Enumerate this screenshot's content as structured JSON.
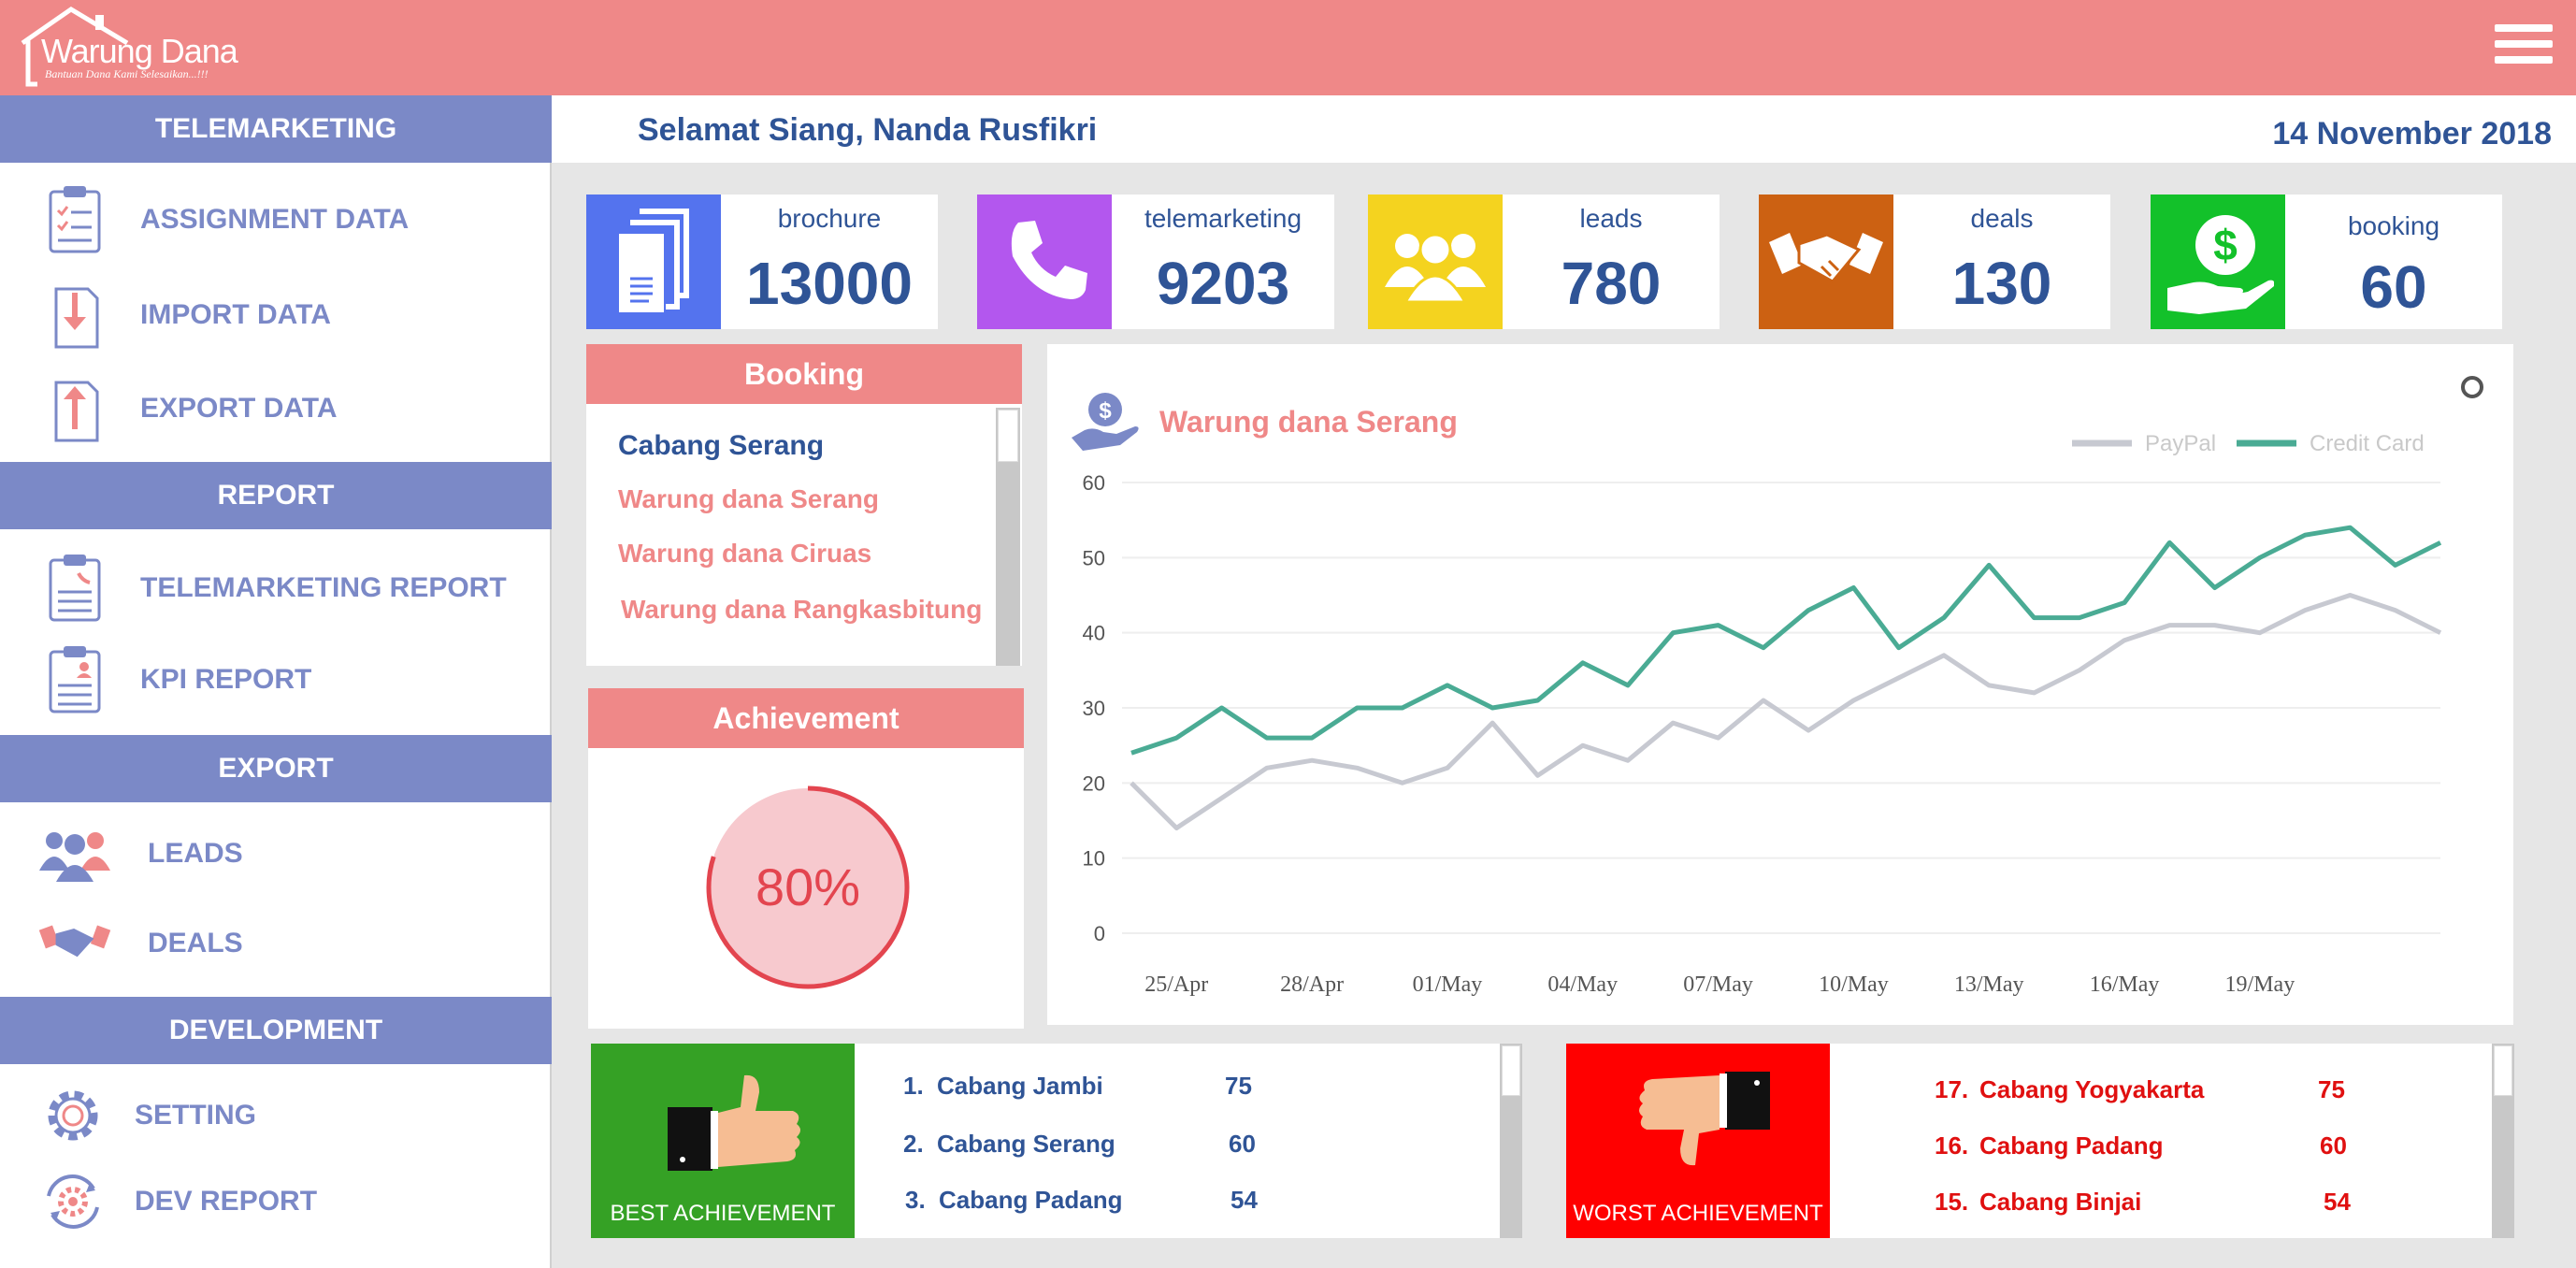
{
  "app": {
    "brand": "Warung Dana",
    "tagline": "Bantuan Dana Kami Selesaikan...!!!"
  },
  "sidebar": {
    "sections": [
      {
        "title": "TELEMARKETING",
        "items": [
          {
            "label": "ASSIGNMENT DATA",
            "icon": "clipboard-checklist-icon"
          },
          {
            "label": "IMPORT DATA",
            "icon": "import-document-icon"
          },
          {
            "label": "EXPORT DATA",
            "icon": "export-document-icon"
          }
        ]
      },
      {
        "title": "REPORT",
        "items": [
          {
            "label": "TELEMARKETING REPORT",
            "icon": "phone-report-icon"
          },
          {
            "label": "KPI REPORT",
            "icon": "person-report-icon"
          }
        ]
      },
      {
        "title": "EXPORT",
        "items": [
          {
            "label": "LEADS",
            "icon": "group-people-icon"
          },
          {
            "label": "DEALS",
            "icon": "handshake-icon"
          }
        ]
      },
      {
        "title": "DEVELOPMENT",
        "items": [
          {
            "label": "SETTING",
            "icon": "gear-icon"
          },
          {
            "label": "DEV REPORT",
            "icon": "gear-cycle-icon"
          }
        ]
      }
    ]
  },
  "header": {
    "greeting": "Selamat Siang, Nanda Rusfikri",
    "date": "14 November 2018"
  },
  "stats": [
    {
      "label": "brochure",
      "value": "13000",
      "color": "#5473ee",
      "icon": "brochure-icon"
    },
    {
      "label": "telemarketing",
      "value": "9203",
      "color": "#b357ee",
      "icon": "phone-icon"
    },
    {
      "label": "leads",
      "value": "780",
      "color": "#f4d31f",
      "icon": "group-people-icon"
    },
    {
      "label": "deals",
      "value": "130",
      "color": "#cc6112",
      "icon": "handshake-icon"
    },
    {
      "label": "booking",
      "value": "60",
      "color": "#13c12a",
      "icon": "money-hand-icon"
    }
  ],
  "booking": {
    "title": "Booking",
    "branch": "Cabang Serang",
    "items": [
      "Warung dana Serang",
      "Warung dana Ciruas",
      "Warung dana Rangkasbitung"
    ]
  },
  "achievement": {
    "title": "Achievement",
    "percent_label": "80%",
    "percent": 80
  },
  "chart_data": {
    "type": "line",
    "title": "Warung dana Serang",
    "legend_position": "top-right",
    "x_tick_labels": [
      "25/Apr",
      "28/Apr",
      "01/May",
      "04/May",
      "07/May",
      "10/May",
      "13/May",
      "16/May",
      "19/May"
    ],
    "y_ticks": [
      0,
      10,
      20,
      30,
      40,
      50,
      60
    ],
    "ylim": [
      0,
      60
    ],
    "grid": true,
    "series": [
      {
        "name": "PayPal",
        "color": "#c7c9d1",
        "values": [
          20,
          14,
          18,
          22,
          23,
          22,
          20,
          22,
          28,
          21,
          25,
          23,
          28,
          26,
          31,
          27,
          31,
          34,
          37,
          33,
          32,
          35,
          39,
          41,
          41,
          40,
          43,
          45,
          43,
          40
        ]
      },
      {
        "name": "Credit Card",
        "color": "#4aab94",
        "values": [
          24,
          26,
          30,
          26,
          26,
          30,
          30,
          33,
          30,
          31,
          36,
          33,
          40,
          41,
          38,
          43,
          46,
          38,
          42,
          49,
          42,
          42,
          44,
          52,
          46,
          50,
          53,
          54,
          49,
          52
        ]
      }
    ]
  },
  "best": {
    "caption": "BEST ACHIEVEMENT",
    "rows": [
      {
        "rank": "1.",
        "name": "Cabang Jambi",
        "score": "75"
      },
      {
        "rank": "2.",
        "name": "Cabang Serang",
        "score": "60"
      },
      {
        "rank": "3.",
        "name": "Cabang Padang",
        "score": "54"
      }
    ]
  },
  "worst": {
    "caption": "WORST ACHIEVEMENT",
    "rows": [
      {
        "rank": "17.",
        "name": "Cabang Yogyakarta",
        "score": "75"
      },
      {
        "rank": "16.",
        "name": "Cabang Padang",
        "score": "60"
      },
      {
        "rank": "15.",
        "name": "Cabang Binjai",
        "score": "54"
      }
    ]
  },
  "colors": {
    "topbar": "#ef8888",
    "sidebar_header": "#7b89c7",
    "text_blue": "#2f5496",
    "best_green": "#35a125",
    "worst_red": "#ff0000"
  }
}
